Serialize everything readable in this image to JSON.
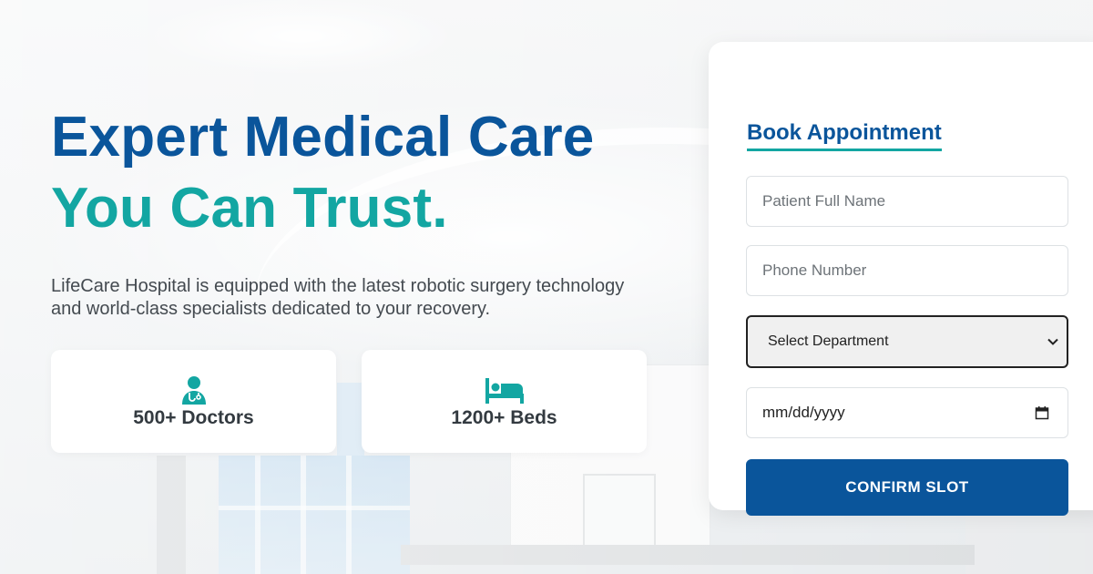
{
  "hero": {
    "title_line1": "Expert Medical Care",
    "title_line2": "You Can Trust.",
    "description": "LifeCare Hospital is equipped with the latest robotic surgery technology and world-class specialists dedicated to your recovery."
  },
  "stats": [
    {
      "icon": "doctor-icon",
      "label": "500+ Doctors"
    },
    {
      "icon": "bed-icon",
      "label": "1200+ Beds"
    }
  ],
  "booking": {
    "title": "Book Appointment",
    "name_placeholder": "Patient Full Name",
    "phone_placeholder": "Phone Number",
    "department_selected": "Select Department",
    "date_placeholder": "mm/dd/yyyy",
    "confirm_label": "CONFIRM SLOT"
  },
  "colors": {
    "primary": "#0a559b",
    "accent": "#13a6a2",
    "text": "#444a50"
  }
}
